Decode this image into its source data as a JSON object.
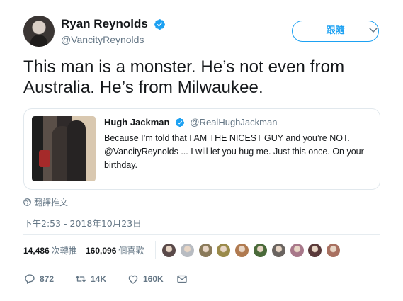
{
  "author": {
    "display_name": "Ryan Reynolds",
    "handle": "@VancityReynolds",
    "verified": true
  },
  "follow_button_label": "跟隨",
  "tweet_text": "This man is a monster.  He’s not even from Australia. He’s from Milwaukee.",
  "quoted_tweet": {
    "display_name": "Hugh Jackman",
    "handle": "@RealHughJackman",
    "verified": true,
    "text": "Because I’m told that I AM THE NICEST GUY and you’re NOT. @VancityReynolds ... I will let you hug me. Just this once. On your birthday."
  },
  "translate_label": "翻譯推文",
  "timestamp": "下午2:53 - 2018年10月23日",
  "stats": {
    "retweets_count": "14,486",
    "retweets_label": "次轉推",
    "likes_count": "160,096",
    "likes_label": "個喜歡"
  },
  "liker_avatar_colors": [
    "#5a4a4a",
    "#b8bcc2",
    "#8a7a5a",
    "#9a8a4a",
    "#b07a50",
    "#4a6a3a",
    "#6a6460",
    "#a8788a",
    "#5a3a3a",
    "#a87060"
  ],
  "actions": {
    "reply_count": "872",
    "retweet_count": "14K",
    "like_count": "160K"
  },
  "colors": {
    "accent": "#1da1f2",
    "text": "#14171a",
    "muted": "#657786",
    "border": "#e1e8ed"
  }
}
